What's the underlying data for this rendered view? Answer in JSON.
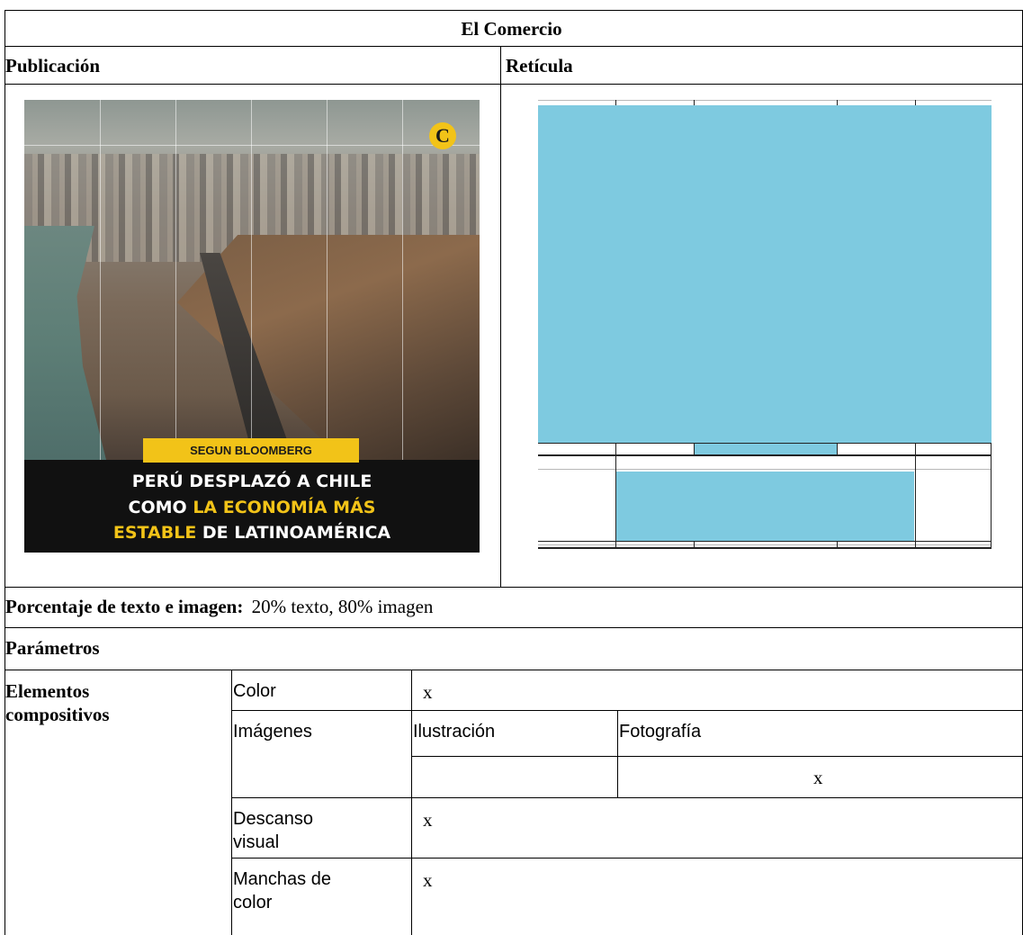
{
  "header": {
    "title": "El Comercio"
  },
  "columns": {
    "publication": "Publicación",
    "grid": "Retícula"
  },
  "publication": {
    "tag": "SEGUN BLOOMBERG",
    "headline": {
      "line1": "PERÚ DESPLAZÓ A CHILE",
      "line2_white": "COMO ",
      "line2_yellow": "LA ECONOMÍA MÁS",
      "line3_yellow": "ESTABLE",
      "line3_white": " DE LATINOAMÉRICA"
    },
    "logo_letter": "C",
    "colors": {
      "accent": "#f2c318",
      "banner": "#111111"
    }
  },
  "grid_color": "#7ecae0",
  "percentage": {
    "label": "Porcentaje de texto e imagen:",
    "value": "20% texto, 80% imagen"
  },
  "parameters": {
    "label": "Parámetros"
  },
  "elements": {
    "group_label_line1": "Elementos",
    "group_label_line2": "compositivos",
    "color": {
      "label": "Color",
      "value": "x"
    },
    "images": {
      "label": "Imágenes",
      "illustration": "Ilustración",
      "photo": "Fotografía",
      "illustration_value": "",
      "photo_value": "x"
    },
    "rest": {
      "label_line1": "Descanso",
      "label_line2": "visual",
      "value": "x"
    },
    "spots": {
      "label_line1": "Manchas de",
      "label_line2": "color",
      "value": "x"
    }
  }
}
